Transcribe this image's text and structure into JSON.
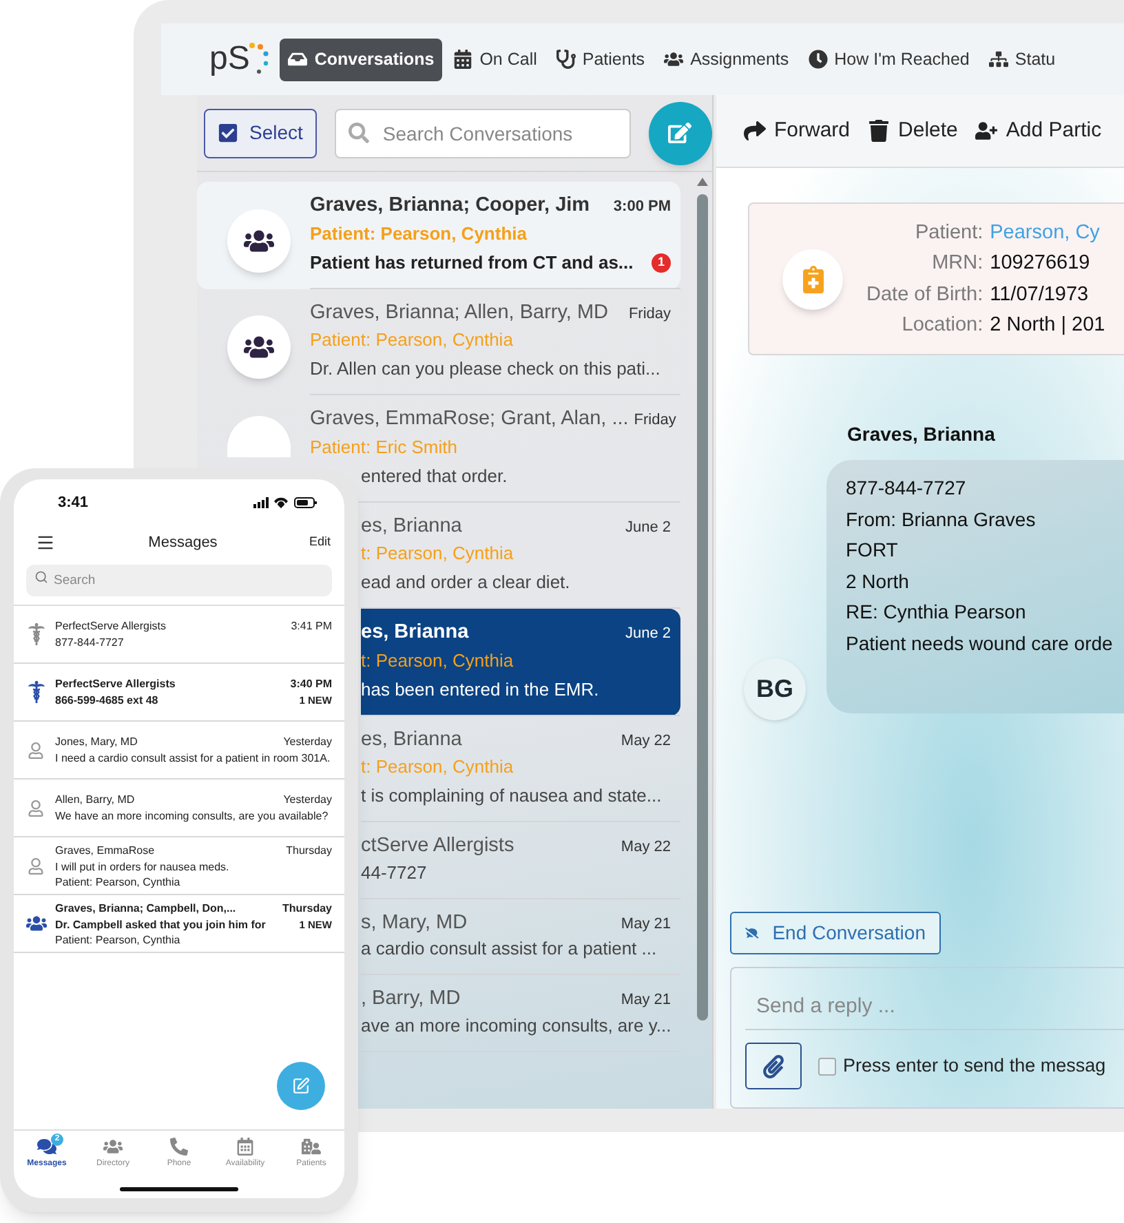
{
  "desktop": {
    "logo": "pS",
    "nav": [
      {
        "label": "Conversations",
        "selected": true
      },
      {
        "label": "On Call",
        "selected": false
      },
      {
        "label": "Patients",
        "selected": false
      },
      {
        "label": "Assignments",
        "selected": false
      },
      {
        "label": "How I'm Reached",
        "selected": false
      },
      {
        "label": "Statu",
        "selected": false
      }
    ],
    "select_button": {
      "label": "Select",
      "checked": true
    },
    "search": {
      "placeholder": "Search Conversations"
    },
    "conversations": [
      {
        "kind": "full",
        "name": "Graves, Brianna; Cooper, Jim",
        "time": "3:00 PM",
        "patient": "Patient: Pearson, Cynthia",
        "preview": "Patient has returned from CT and as...",
        "unread": true,
        "selected": false,
        "badge": "1"
      },
      {
        "kind": "full",
        "name": "Graves, Brianna; Allen, Barry, MD",
        "time": "Friday",
        "patient": "Patient: Pearson, Cynthia",
        "preview": "Dr. Allen can you please check on this pati...",
        "unread": false,
        "selected": false
      },
      {
        "kind": "half",
        "name": "Graves, EmmaRose; Grant, Alan, ...",
        "time": "Friday",
        "patient": "Patient: Eric Smith",
        "preview": "entered that order.",
        "unread": false,
        "selected": false
      },
      {
        "kind": "covered",
        "name": "es, Brianna",
        "time": "June 2",
        "patient": "t: Pearson, Cynthia",
        "preview": "ead and order a clear diet.",
        "unread": false,
        "selected": false
      },
      {
        "kind": "covered",
        "name": "es, Brianna",
        "time": "June 2",
        "patient": "t: Pearson, Cynthia",
        "preview": "has been entered in the EMR.",
        "unread": false,
        "selected": true
      },
      {
        "kind": "covered",
        "name": "es, Brianna",
        "time": "May 22",
        "patient": "t: Pearson, Cynthia",
        "preview": "t is complaining of nausea and state...",
        "unread": false,
        "selected": false
      },
      {
        "kind": "covered",
        "name": "ctServe Allergists",
        "time": "May 22",
        "preview": "44-7727",
        "unread": false,
        "selected": false
      },
      {
        "kind": "covered",
        "name": "s, Mary, MD",
        "time": "May 21",
        "preview": "a cardio consult assist for a patient ...",
        "unread": false,
        "selected": false
      },
      {
        "kind": "covered",
        "name": ", Barry, MD",
        "time": "May 21",
        "preview": "ave an more incoming consults, are y...",
        "unread": false,
        "selected": false
      }
    ],
    "toolbar": [
      "Forward",
      "Delete",
      "Add Partic"
    ],
    "patient_card": [
      {
        "label": "Patient:",
        "value": "Pearson, Cy",
        "kind": "link"
      },
      {
        "label": "MRN:",
        "value": "109276619",
        "kind": "text"
      },
      {
        "label": "Date of Birth:",
        "value": "11/07/1973",
        "kind": "text"
      },
      {
        "label": "Location:",
        "value": "2 North | 201",
        "kind": "text"
      }
    ],
    "message": {
      "sender": "Graves, Brianna",
      "initials": "BG",
      "lines": [
        "877-844-7727",
        "From: Brianna Graves",
        "FORT",
        "2 North",
        "RE: Cynthia Pearson",
        "Patient needs wound care orde"
      ]
    },
    "end_button": "End Conversation",
    "reply": {
      "placeholder": "Send a reply ...",
      "enter_to_send": {
        "label": "Press enter to send the messag",
        "checked": false
      }
    }
  },
  "phone": {
    "time": "3:41",
    "title": "Messages",
    "edit": "Edit",
    "search": {
      "placeholder": "Search"
    },
    "messages": [
      {
        "kind": "service",
        "unread": false,
        "name": "PerfectServe Allergists",
        "lines": [
          "877-844-7727"
        ],
        "time": "3:41 PM"
      },
      {
        "kind": "service",
        "unread": true,
        "name": "PerfectServe Allergists",
        "lines": [
          "866-599-4685 ext 48"
        ],
        "time": "3:40 PM",
        "new": "1 NEW"
      },
      {
        "kind": "person",
        "unread": false,
        "name": "Jones, Mary, MD",
        "lines": [
          "I need a cardio consult assist for a patient in room 301A."
        ],
        "time": "Yesterday"
      },
      {
        "kind": "person",
        "unread": false,
        "name": "Allen, Barry, MD",
        "lines": [
          "We have an more incoming consults, are you available?"
        ],
        "time": "Yesterday"
      },
      {
        "kind": "person",
        "unread": false,
        "name": "Graves, EmmaRose",
        "lines": [
          "I will put in orders for nausea meds.",
          "Patient: Pearson, Cynthia"
        ],
        "time": "Thursday"
      },
      {
        "kind": "group",
        "unread": true,
        "name": "Graves, Brianna; Campbell, Don,...",
        "lines": [
          "Dr. Campbell asked that you join him for",
          "Patient: Pearson, Cynthia"
        ],
        "time": "Thursday",
        "new": "1 NEW"
      }
    ],
    "tabs": [
      {
        "label": "Messages",
        "selected": true,
        "badge": "2"
      },
      {
        "label": "Directory",
        "selected": false
      },
      {
        "label": "Phone",
        "selected": false
      },
      {
        "label": "Availability",
        "selected": false
      },
      {
        "label": "Patients",
        "selected": false
      }
    ]
  }
}
